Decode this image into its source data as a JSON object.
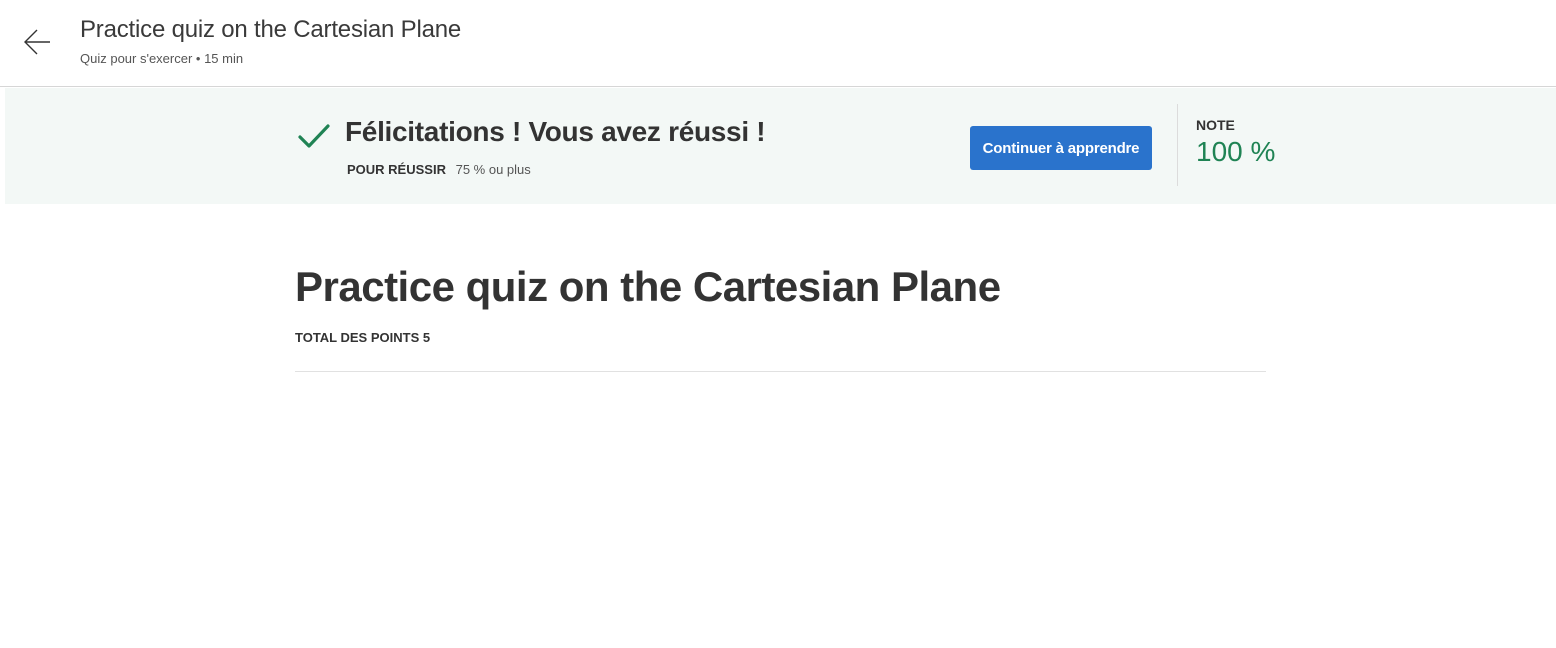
{
  "header": {
    "back_icon": "arrow-left-icon",
    "title": "Practice quiz on the Cartesian Plane",
    "subtitle": "Quiz pour s'exercer • 15  min"
  },
  "banner": {
    "status_icon": "checkmark-icon",
    "heading": "Félicitations ! Vous avez réussi !",
    "pass_label": "POUR RÉUSSIR",
    "pass_value": "75 % ou plus",
    "continue_label": "Continuer à apprendre",
    "grade_label": "NOTE",
    "grade_value": "100 %",
    "colors": {
      "background": "#f3f8f6",
      "check": "#1f8354",
      "button": "#2a73cc",
      "grade": "#1f8354"
    }
  },
  "main": {
    "title": "Practice quiz on the Cartesian Plane",
    "total_points": "TOTAL DES POINTS 5"
  }
}
